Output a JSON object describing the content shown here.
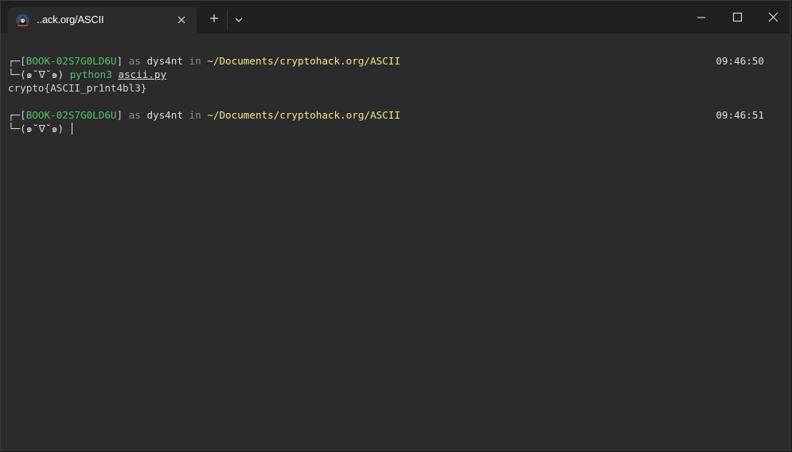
{
  "tab": {
    "title": "..ack.org/ASCII",
    "icon": "hacker-avatar-icon"
  },
  "titlebar": {
    "new_tab_icon": "plus-icon",
    "dropdown_icon": "chevron-down-icon",
    "minimize_icon": "minimize-icon",
    "maximize_icon": "maximize-icon",
    "close_icon": "close-icon"
  },
  "terminal": {
    "prompt1": {
      "corner": "┌─",
      "host_open": "[",
      "host": "BOOK-02S7G0LD6U",
      "host_close": "]",
      "as_word": " as ",
      "user": "dys4nt",
      "in_word": " in ",
      "path": "~/Documents/cryptohack.org/ASCII",
      "time": "09:46:50"
    },
    "command_line": {
      "corner": "└─",
      "face": "(๑˘ᐁ˘๑)",
      "command": "python3",
      "argument": "ascii.py"
    },
    "output": "crypto{ASCII_pr1nt4bl3}",
    "prompt2": {
      "corner": "┌─",
      "host_open": "[",
      "host": "BOOK-02S7G0LD6U",
      "host_close": "]",
      "as_word": " as ",
      "user": "dys4nt",
      "in_word": " in ",
      "path": "~/Documents/cryptohack.org/ASCII",
      "time": "09:46:51"
    },
    "current_line": {
      "corner": "└─",
      "face": "(๑˘ᐁ˘๑)"
    }
  },
  "colors": {
    "background": "#2b2b2b",
    "titlebar": "#202020",
    "host": "#55c070",
    "path": "#f0e68c",
    "dim": "#8a8a8a"
  }
}
